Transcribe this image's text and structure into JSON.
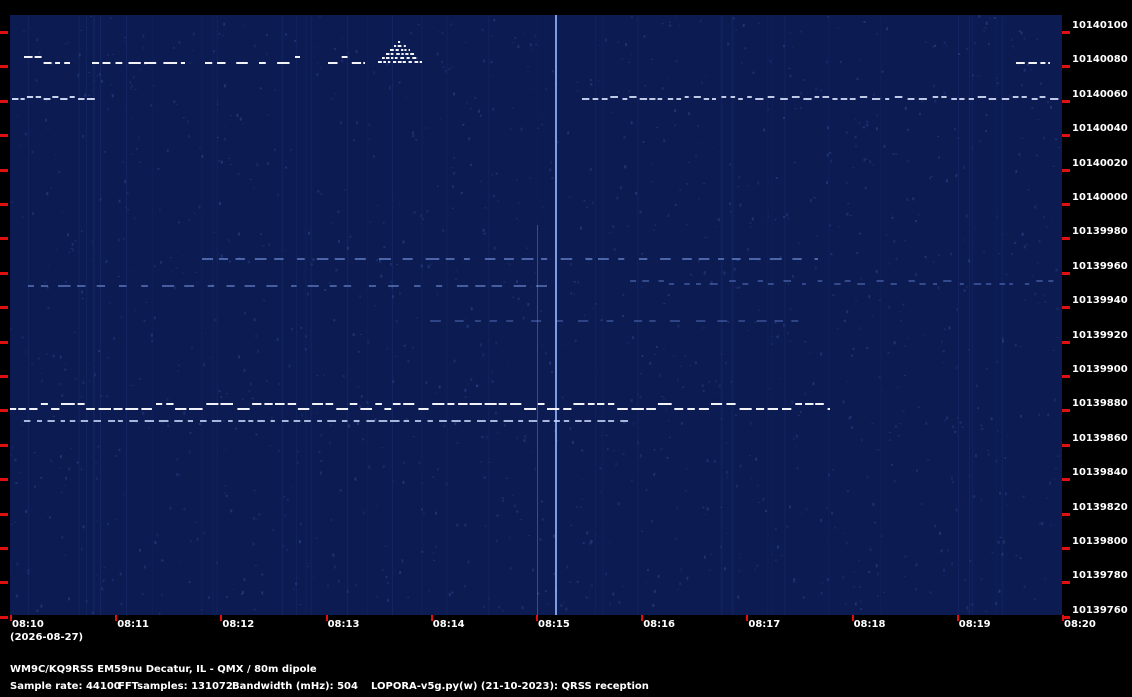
{
  "chart_data": {
    "type": "heatmap",
    "y_ticks": [
      "10140100",
      "10140080",
      "10140060",
      "10140040",
      "10140020",
      "10140000",
      "10139980",
      "10139960",
      "10139940",
      "10139920",
      "10139900",
      "10139880",
      "10139860",
      "10139840",
      "10139820",
      "10139800",
      "10139780",
      "10139760"
    ],
    "x_ticks": [
      "08:10",
      "08:11",
      "08:12",
      "08:13",
      "08:14",
      "08:15",
      "08:16",
      "08:17",
      "08:18",
      "08:19",
      "08:20"
    ],
    "date": "(2026-08-27)",
    "colors": {
      "background": "#0c1b52",
      "signal": "#ffffff",
      "tick_marks": "#e01010"
    }
  },
  "footer": {
    "station": "WM9C/KQ9RSS EM59nu Decatur, IL - QMX / 80m dipole",
    "sample_rate": "Sample rate: 44100",
    "fft_samples": "FFTsamples: 131072",
    "bandwidth": "Bandwidth (mHz): 504",
    "software": "LOPORA-v5g.py(w) (21-10-2023): QRSS reception"
  }
}
